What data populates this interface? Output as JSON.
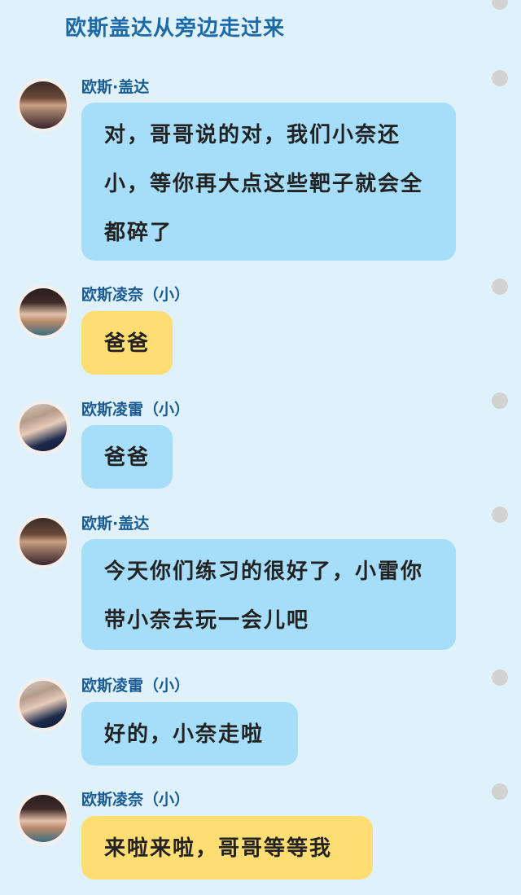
{
  "narration": "欧斯盖达从旁边走过来",
  "messages": [
    {
      "name": "欧斯·盖达",
      "text": "对，哥哥说的对，我们小奈还小，等你再大点这些靶子就会全都碎了",
      "bubble": "blue",
      "avatar": "father-avatar"
    },
    {
      "name": "欧斯凌奈（小）",
      "text": "爸爸",
      "bubble": "yellow",
      "avatar": "girl-avatar"
    },
    {
      "name": "欧斯凌雷（小）",
      "text": "爸爸",
      "bubble": "blue",
      "avatar": "boy-avatar"
    },
    {
      "name": "欧斯·盖达",
      "text": "今天你们练习的很好了，小雷你带小奈去玩一会儿吧",
      "bubble": "blue",
      "avatar": "father-avatar"
    },
    {
      "name": "欧斯凌雷（小）",
      "text": "好的，小奈走啦",
      "bubble": "blue",
      "avatar": "boy-avatar"
    },
    {
      "name": "欧斯凌奈（小）",
      "text": "来啦来啦，哥哥等等我",
      "bubble": "yellow",
      "avatar": "girl-avatar"
    }
  ],
  "colors": {
    "background": "#dff2fb",
    "blue_bubble": "#a6ddf8",
    "yellow_bubble": "#fedd73",
    "name": "#1a5b94",
    "narration": "#1d6aa8"
  }
}
